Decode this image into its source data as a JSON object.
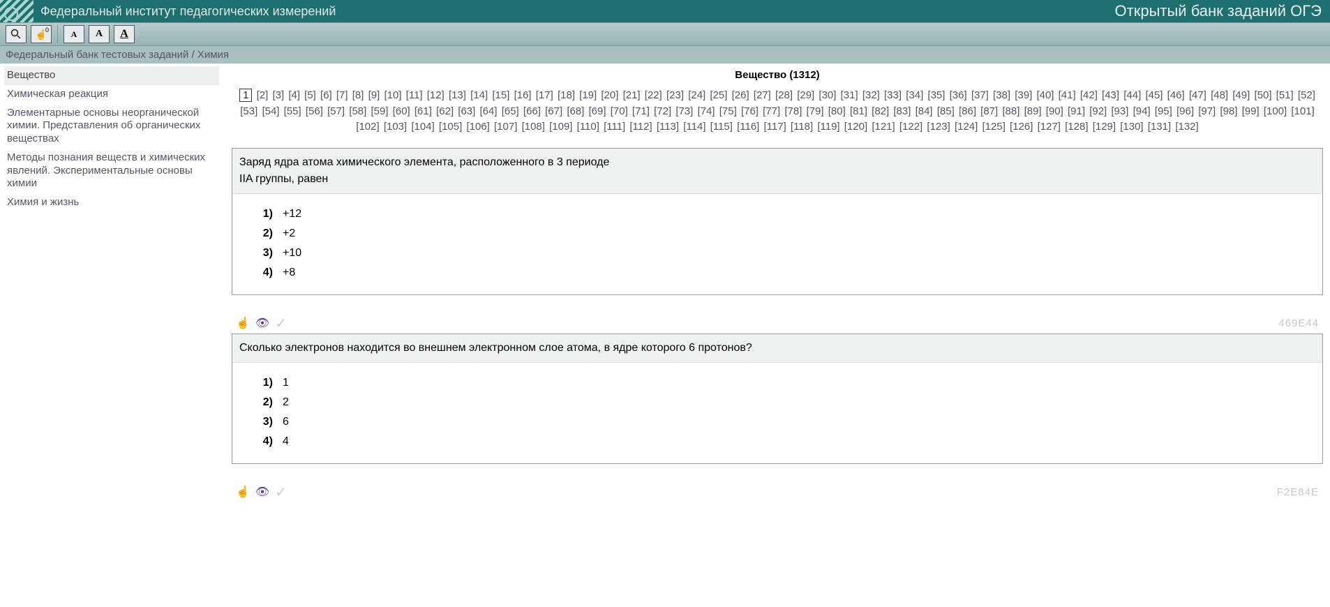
{
  "header": {
    "title": "Федеральный институт педагогических измерений",
    "right": "Открытый банк заданий ОГЭ"
  },
  "toolbar": {
    "hand_badge": "0"
  },
  "breadcrumb": "Федеральный банк тестовых заданий / Химия",
  "sidebar": {
    "items": [
      {
        "label": "Вещество",
        "active": true
      },
      {
        "label": "Химическая реакция",
        "active": false
      },
      {
        "label": "Элементарные основы неорганической химии. Представления об органических веществах",
        "active": false
      },
      {
        "label": "Методы познания веществ и химических явлений. Экспериментальные основы химии",
        "active": false
      },
      {
        "label": "Химия и жизнь",
        "active": false
      }
    ]
  },
  "main": {
    "title": "Вещество (1312)",
    "pagination": {
      "current": 1,
      "total_pages": 132
    },
    "questions": [
      {
        "text": "Заряд ядра атома химического элемента, расположенного в 3 периоде\nIIA группы, равен",
        "answers": [
          "+12",
          "+2",
          "+10",
          "+8"
        ],
        "id": "469E44"
      },
      {
        "text": "Сколько электронов находится во внешнем электронном слое атома, в ядре которого 6 протонов?",
        "answers": [
          "1",
          "2",
          "6",
          "4"
        ],
        "id": "F2E84E"
      }
    ]
  }
}
